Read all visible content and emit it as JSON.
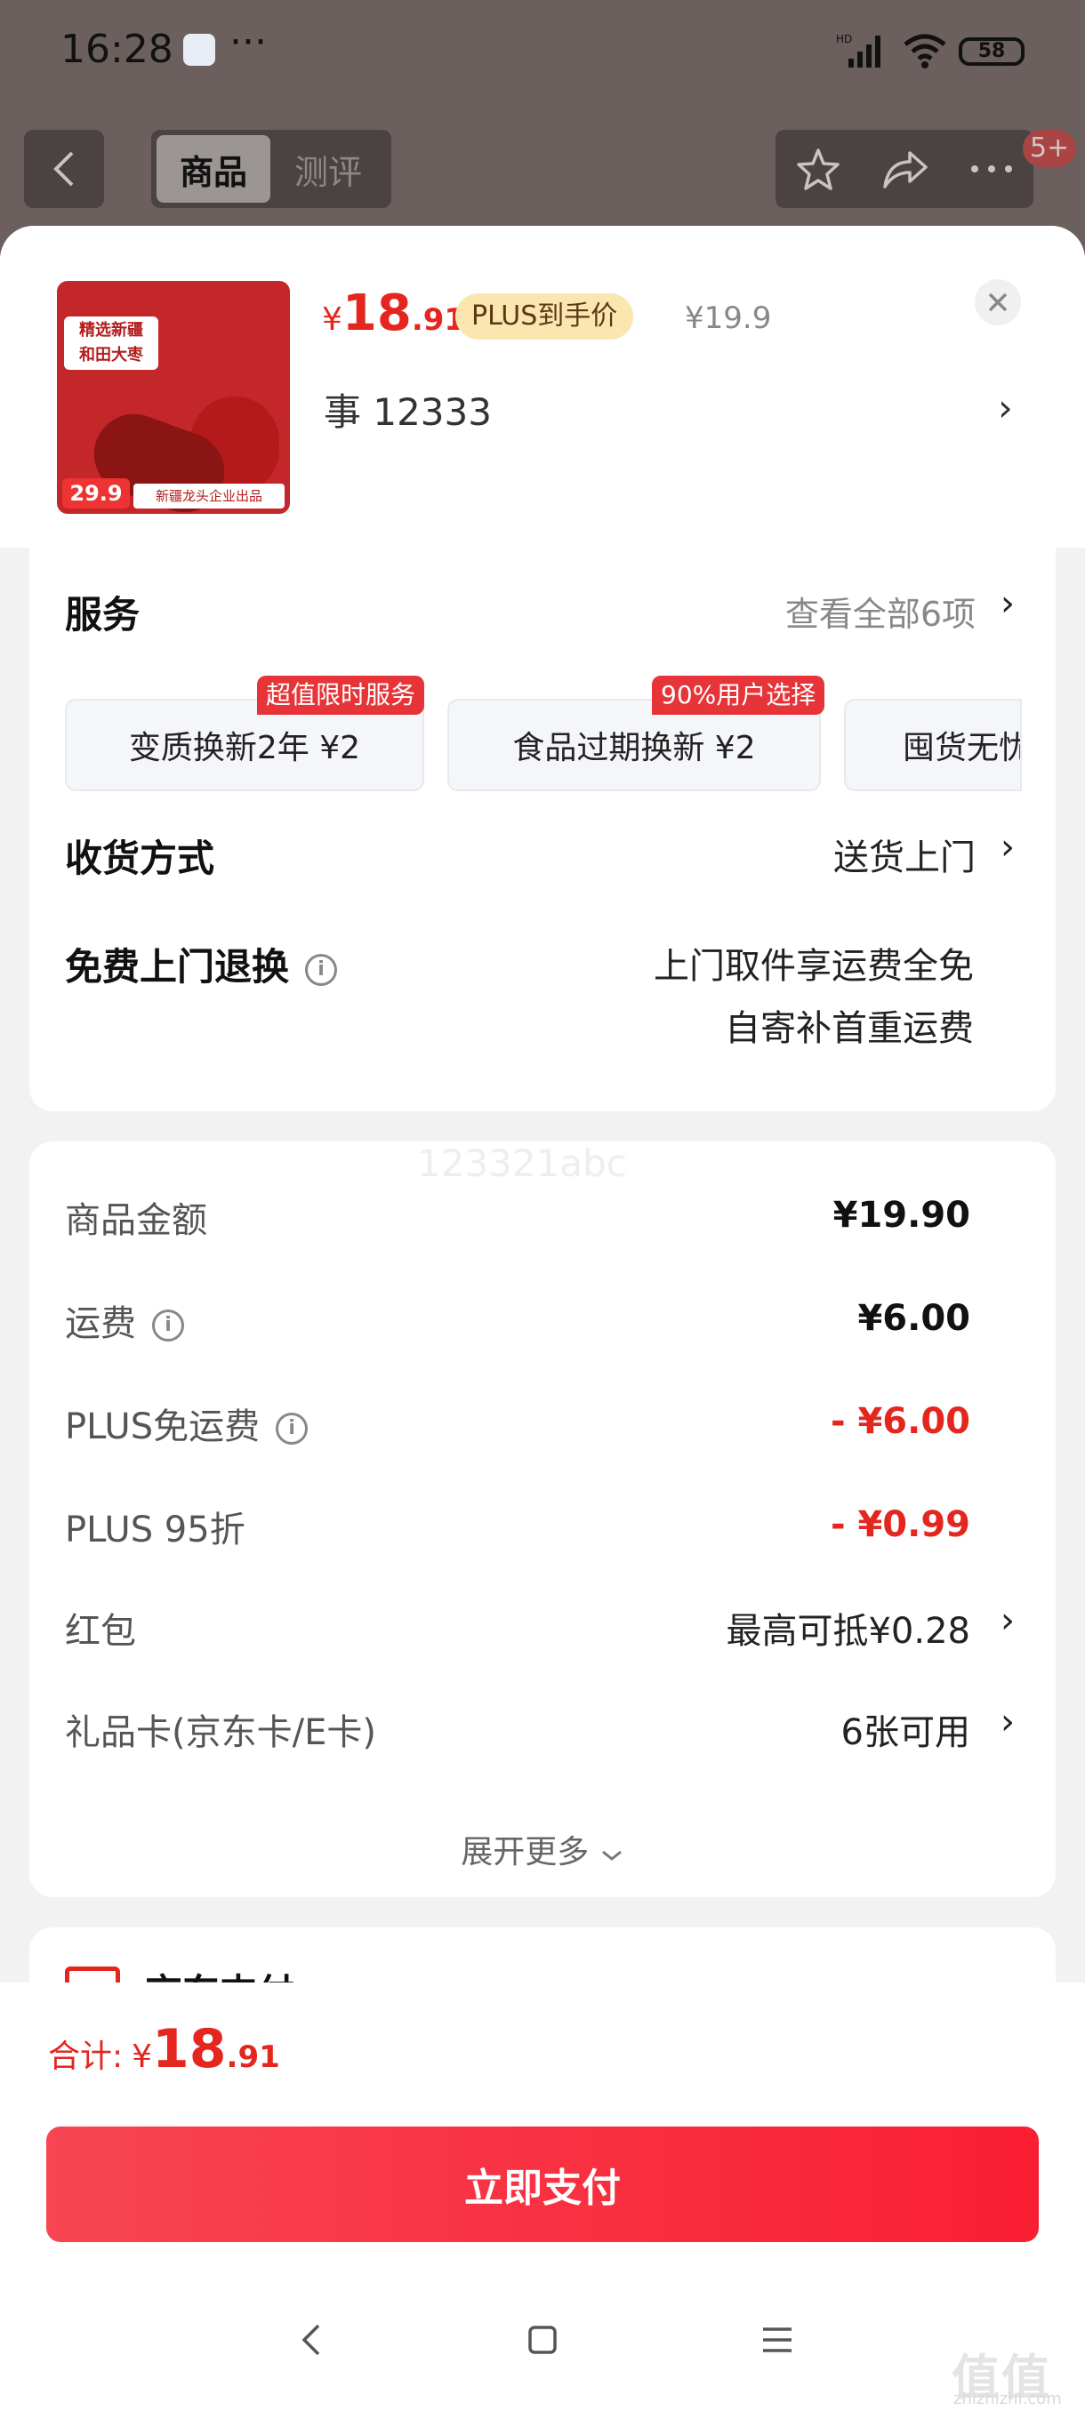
{
  "status_bar": {
    "time": "16:28",
    "dots": "···",
    "net": "HD",
    "battery": "58"
  },
  "top_nav": {
    "tab_goods": "商品",
    "tab_review": "测评",
    "badge": "5+"
  },
  "product": {
    "currency": "¥",
    "price_int": "18",
    "price_dec": ".91",
    "plus_tag": "PLUS到手价",
    "original_price": "¥19.9",
    "sku": "事  12333",
    "thumb_title": "精选新疆\n和田大枣",
    "thumb_price": "29.9",
    "thumb_band": "新疆龙头企业出品"
  },
  "services": {
    "title": "服务",
    "view_all": "查看全部6项",
    "items": [
      {
        "label": "变质换新2年  ¥2",
        "badge": "超值限时服务"
      },
      {
        "label": "食品过期换新  ¥2",
        "badge": "90%用户选择"
      },
      {
        "label": "囤货无忧",
        "badge": ""
      }
    ]
  },
  "delivery": {
    "label": "收货方式",
    "value": "送货上门"
  },
  "free_return": {
    "label": "免费上门退换",
    "line1": "上门取件享运费全免",
    "line2": "自寄补首重运费"
  },
  "fees": {
    "watermark": "123321abc",
    "goods_amount_label": "商品金额",
    "goods_amount": "¥19.90",
    "shipping_label": "运费",
    "shipping": "¥6.00",
    "plus_free_label": "PLUS免运费",
    "plus_free": "- ¥6.00",
    "plus95_label": "PLUS 95折",
    "plus95": "- ¥0.99",
    "redpacket_label": "红包",
    "redpacket": "最高可抵¥0.28",
    "giftcard_label": "礼品卡(京东卡/E卡)",
    "giftcard": "6张可用",
    "expand": "展开更多"
  },
  "cashier": {
    "label": "京东支付"
  },
  "footer": {
    "total_label": "合计:",
    "total_currency": "¥",
    "total_int": "18",
    "total_dec": ".91",
    "pay_button": "立即支付",
    "logo": "值值值",
    "logo_sub": "zhizhizhi.com"
  },
  "colors": {
    "accent": "#e4261f",
    "pay_gradient_start": "#f74552",
    "pay_gradient_end": "#fa1e32",
    "plus_tag_bg": "#fbe6b0"
  }
}
